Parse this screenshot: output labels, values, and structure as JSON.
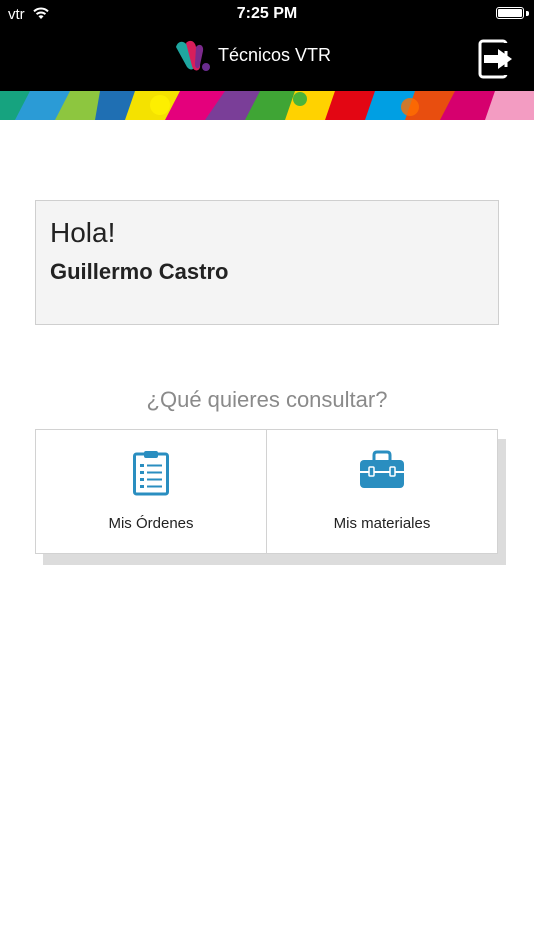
{
  "status_bar": {
    "carrier": "vtr",
    "time": "7:25 PM"
  },
  "header": {
    "title": "Técnicos VTR"
  },
  "greeting": {
    "hello": "Hola!",
    "name": "Guillermo Castro"
  },
  "prompt": "¿Qué quieres consultar?",
  "tiles": [
    {
      "label": "Mis Órdenes",
      "icon": "clipboard-list-icon"
    },
    {
      "label": "Mis materiales",
      "icon": "toolbox-icon"
    }
  ],
  "colors": {
    "accent": "#2a8ec0",
    "header_bg": "#000000",
    "card_bg": "#f4f4f4"
  }
}
